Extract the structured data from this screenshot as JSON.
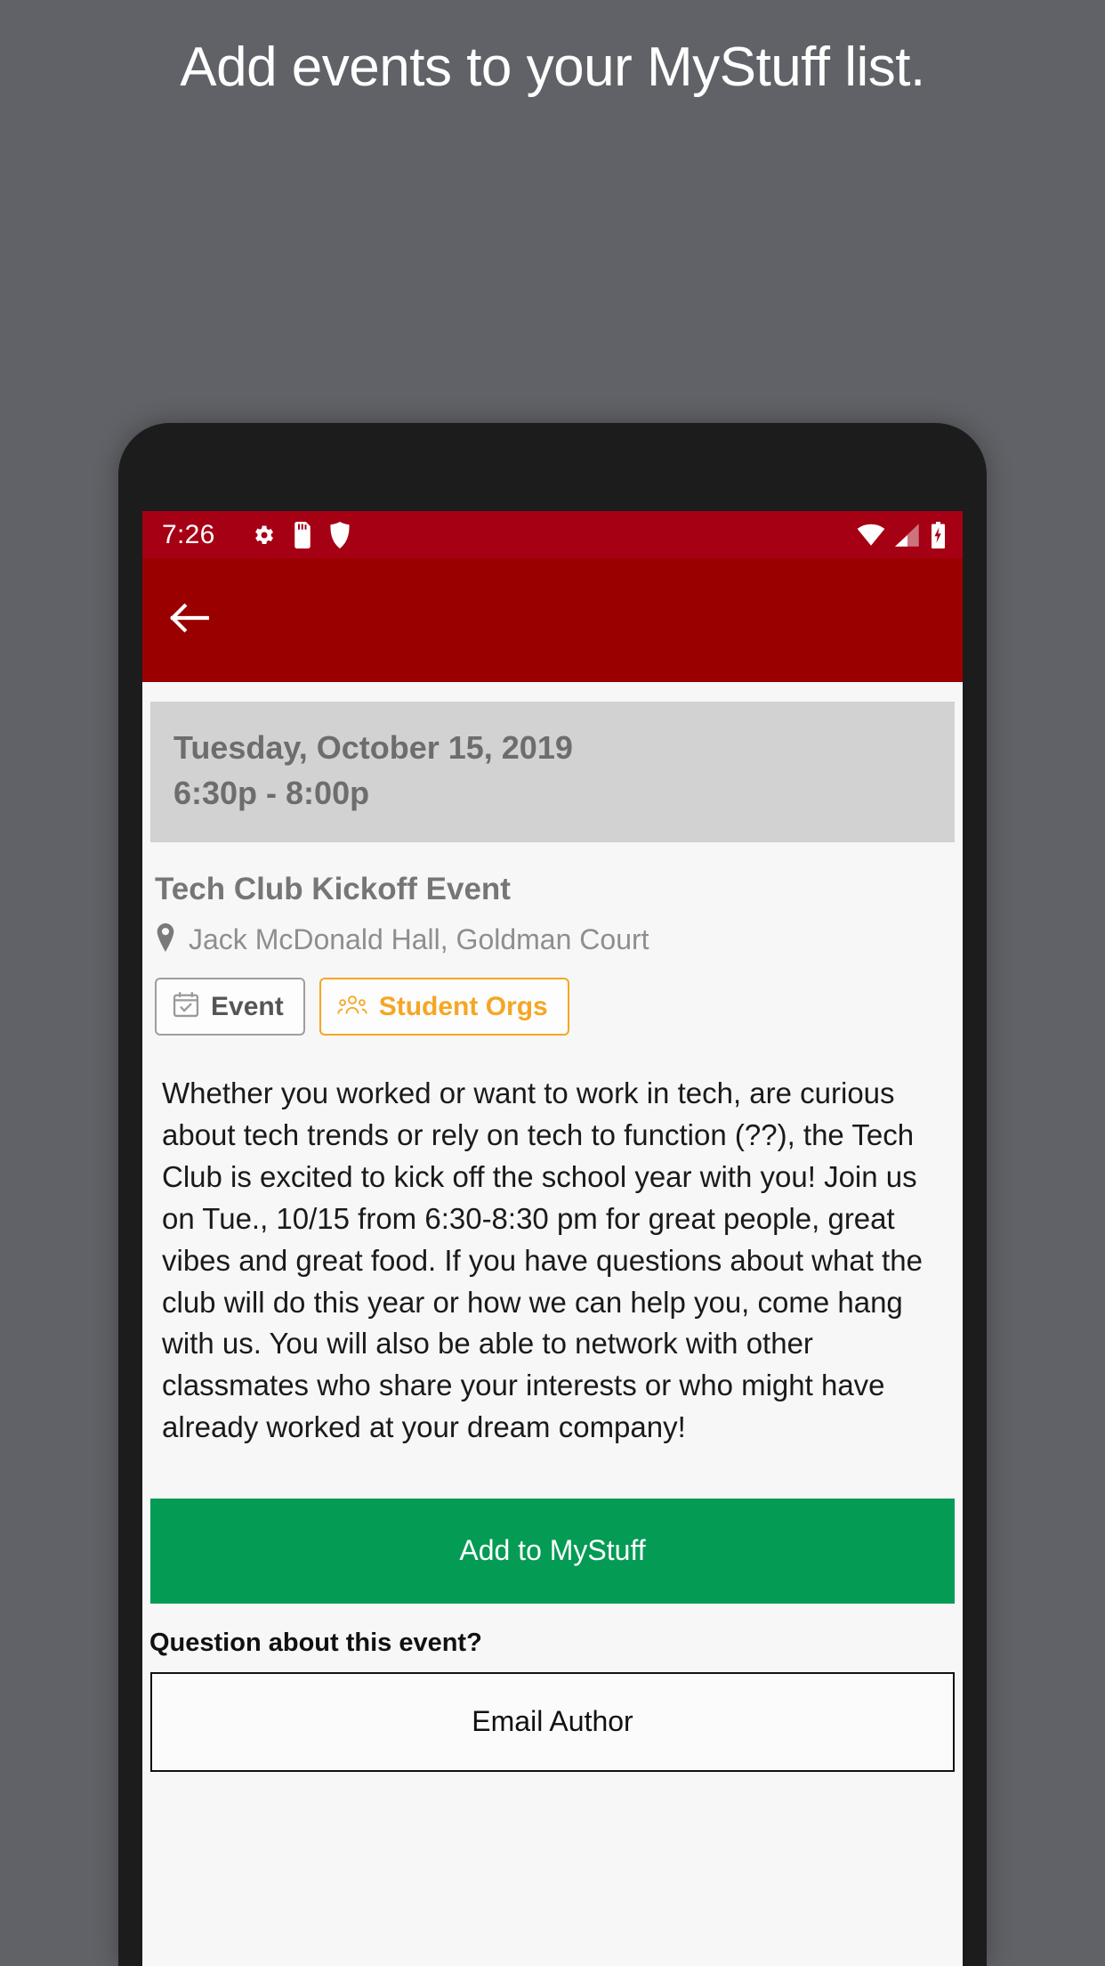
{
  "promo": {
    "headline": "Add events to your MyStuff list."
  },
  "colors": {
    "background": "#606267",
    "status_bar": "#a50014",
    "app_bar": "#9b0000",
    "screen_background": "#f7f7f7",
    "date_card": "#d2d2d2",
    "accent_orange": "#f5a623",
    "primary_green": "#049b55",
    "device_frame": "#1c1c1c"
  },
  "status_bar": {
    "time": "7:26",
    "left_icons": [
      "gear-icon",
      "sd-card-icon",
      "shield-icon"
    ],
    "right_icons": [
      "wifi-icon",
      "cell-signal-icon",
      "battery-charging-icon"
    ]
  },
  "app_bar": {
    "back_icon": "arrow-left-icon",
    "title": ""
  },
  "event": {
    "date": "Tuesday, October 15, 2019",
    "time_range": "6:30p - 8:00p",
    "title": "Tech Club Kickoff Event",
    "location": "Jack McDonald Hall, Goldman Court",
    "location_icon": "map-pin-icon",
    "tags": [
      {
        "label": "Event",
        "icon": "calendar-check-icon",
        "style": "gray"
      },
      {
        "label": "Student Orgs",
        "icon": "people-group-icon",
        "style": "orange"
      }
    ],
    "description": "Whether you worked or want to work in tech, are curious about tech trends or rely on tech to function (??), the Tech Club is excited to kick off the school year with you! Join us on Tue., 10/15 from 6:30-8:30 pm for great people, great vibes and great food. If you have questions about what the club will do this year or how we can help you, come hang with us. You will also be able to network with other classmates who share your interests or who might have already worked at your dream company!"
  },
  "actions": {
    "add_to_mystuff": "Add to MyStuff",
    "question_label": "Question about this event?",
    "email_author": "Email Author"
  }
}
